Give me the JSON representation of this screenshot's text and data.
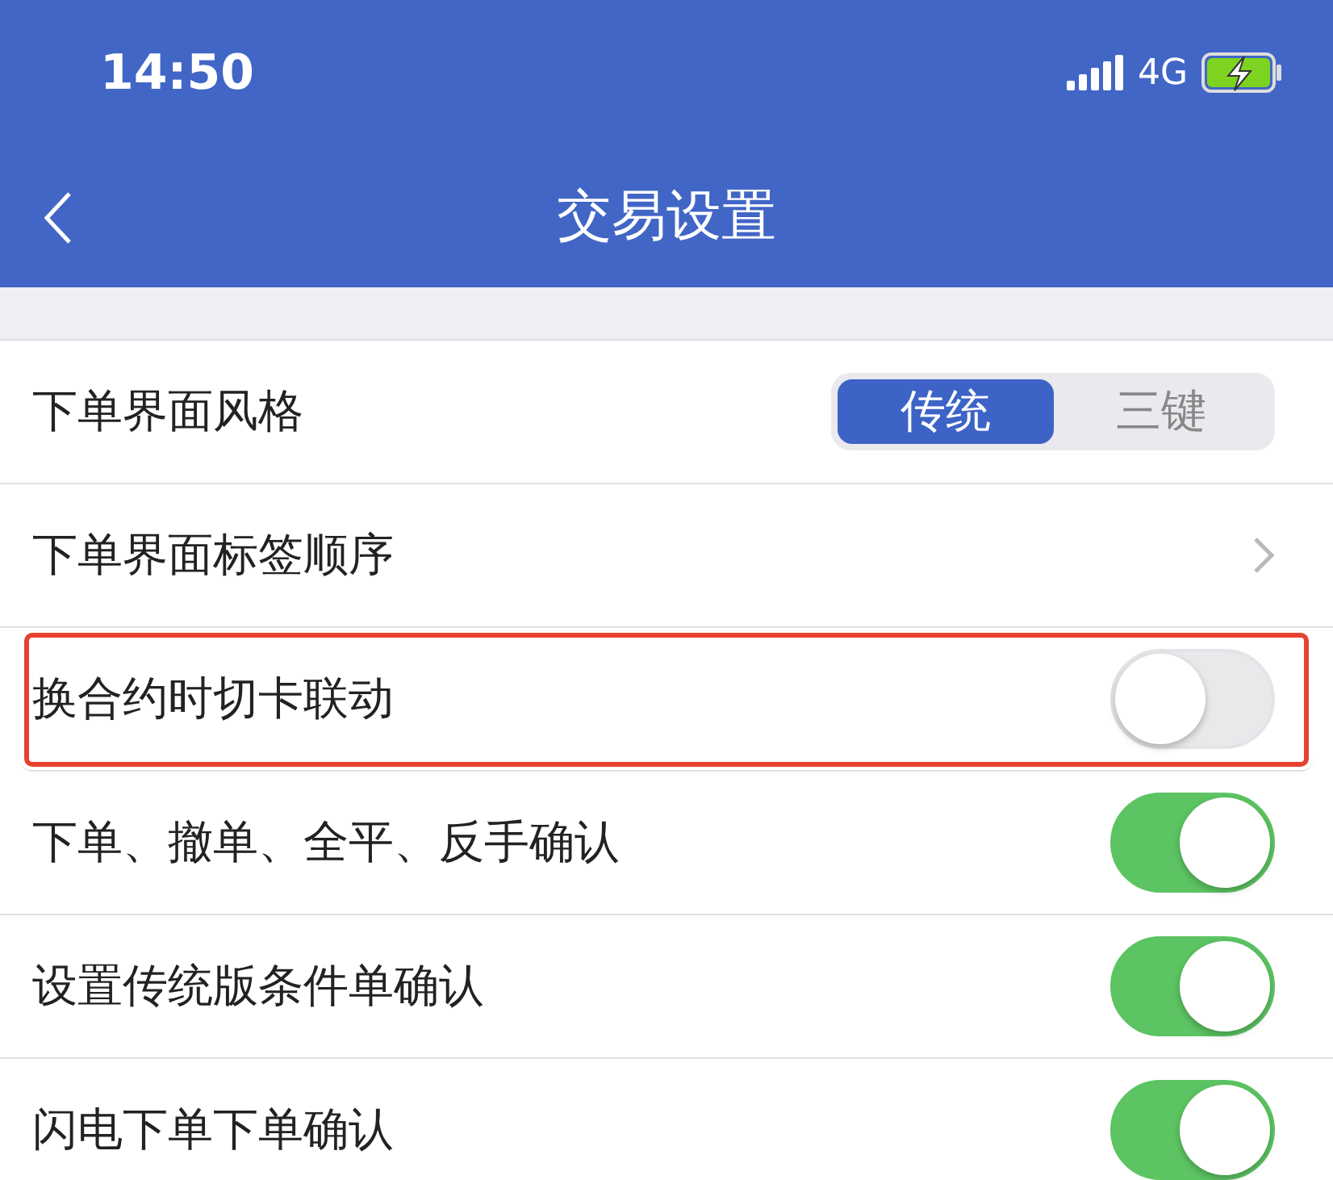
{
  "status_bar": {
    "time": "14:50",
    "network": "4G"
  },
  "nav": {
    "title": "交易设置"
  },
  "settings": [
    {
      "kind": "segmented",
      "label": "下单界面风格",
      "highlighted": false,
      "options": [
        {
          "label": "传统",
          "selected": true
        },
        {
          "label": "三键",
          "selected": false
        }
      ]
    },
    {
      "kind": "link",
      "label": "下单界面标签顺序",
      "highlighted": false
    },
    {
      "kind": "toggle",
      "label": "换合约时切卡联动",
      "on": false,
      "highlighted": true
    },
    {
      "kind": "toggle",
      "label": "下单、撤单、全平、反手确认",
      "on": true,
      "highlighted": false
    },
    {
      "kind": "toggle",
      "label": "设置传统版条件单确认",
      "on": true,
      "highlighted": false
    },
    {
      "kind": "toggle",
      "label": "闪电下单下单确认",
      "on": true,
      "highlighted": false
    }
  ]
}
